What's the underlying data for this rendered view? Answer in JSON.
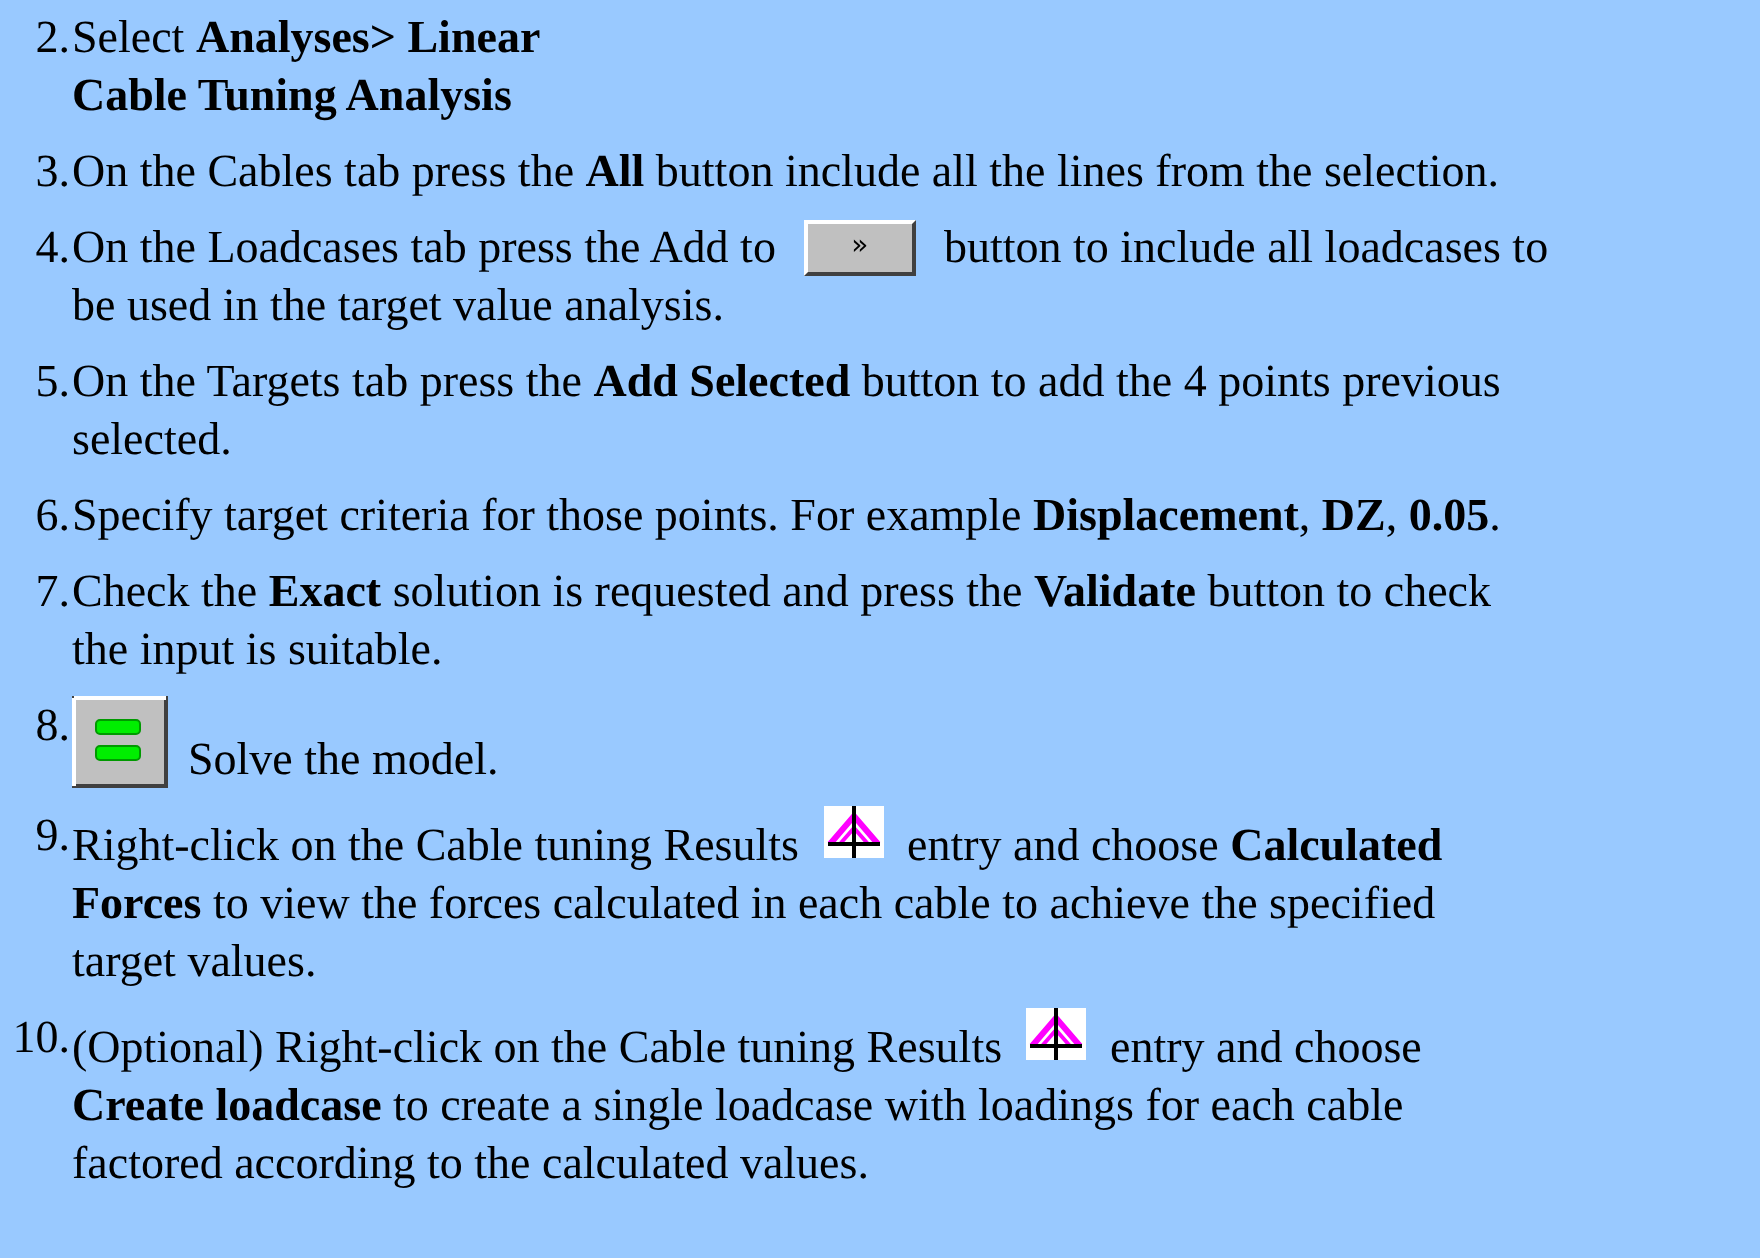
{
  "steps": [
    {
      "number": "2.",
      "lines": [
        [
          {
            "kind": "text",
            "text": "Select **Analyses> Linear**"
          }
        ],
        [
          {
            "kind": "text",
            "text": "**Cable Tuning Analysis**"
          }
        ]
      ]
    },
    {
      "number": "3.",
      "lines": [
        [
          {
            "kind": "text",
            "text": "On the Cables tab press the **All** button include all the lines from the selection."
          }
        ]
      ]
    },
    {
      "number": "4.",
      "lines": [
        [
          {
            "kind": "text",
            "text": "On the Loadcases tab press the Add to"
          },
          {
            "kind": "button",
            "label": "»"
          },
          {
            "kind": "text",
            "text": "button to include all loadcases to"
          }
        ],
        [
          {
            "kind": "text",
            "text": "be used in the target value analysis."
          }
        ]
      ]
    },
    {
      "number": "5.",
      "lines": [
        [
          {
            "kind": "text",
            "text": "On the Targets tab press the **Add Selected** button to add the 4 points previous"
          }
        ],
        [
          {
            "kind": "text",
            "text": "selected."
          }
        ]
      ]
    },
    {
      "number": "6.",
      "lines": [
        [
          {
            "kind": "text",
            "text": "Specify target criteria for those points. For example **Displacement**, **DZ**, **0.05**."
          }
        ]
      ]
    },
    {
      "number": "7.",
      "lines": [
        [
          {
            "kind": "text",
            "text": "Check the **Exact** solution is requested and press the **Validate** button to check"
          }
        ],
        [
          {
            "kind": "text",
            "text": "the input is suitable."
          }
        ]
      ]
    },
    {
      "number": "8.",
      "lines": [
        [
          {
            "kind": "solve"
          },
          {
            "kind": "text",
            "text": "Solve the model."
          }
        ]
      ]
    },
    {
      "number": "9.",
      "lines": [
        [
          {
            "kind": "text",
            "text": "Right-click on the Cable tuning Results"
          },
          {
            "kind": "results"
          },
          {
            "kind": "text",
            "text": "entry and choose **Calculated**"
          }
        ],
        [
          {
            "kind": "text",
            "text": "**Forces** to view the forces calculated in each cable to achieve the specified"
          }
        ],
        [
          {
            "kind": "text",
            "text": "target values."
          }
        ]
      ]
    },
    {
      "number": "10.",
      "lines": [
        [
          {
            "kind": "text",
            "text": "(Optional) Right-click on the Cable tuning Results"
          },
          {
            "kind": "results"
          },
          {
            "kind": "text",
            "text": "entry and choose"
          }
        ],
        [
          {
            "kind": "text",
            "text": "**Create loadcase** to create a single loadcase with loadings for each cable"
          }
        ],
        [
          {
            "kind": "text",
            "text": "factored according to the calculated values."
          }
        ]
      ]
    }
  ]
}
